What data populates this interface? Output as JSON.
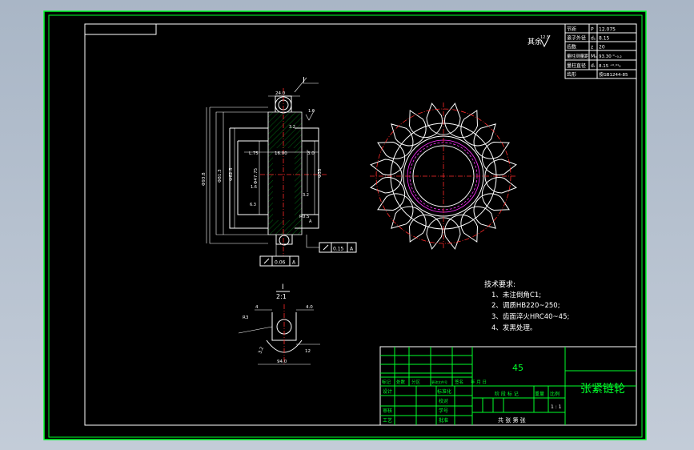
{
  "drawing": {
    "roughness_symbol": "其余",
    "roughness_value": "12.5",
    "material_cell": "45",
    "part_name": "张紧链轮"
  },
  "parameters_table": [
    {
      "label": "节距",
      "symbol": "P",
      "value": "12.075"
    },
    {
      "label": "滚子外径",
      "symbol": "d₁",
      "value": "8.15"
    },
    {
      "label": "齿数",
      "symbol": "z",
      "value": "20"
    },
    {
      "label": "量柱测量距",
      "symbol": "Mᵤ",
      "value": "93.30 ⁰₋₀.₂"
    },
    {
      "label": "量柱直径",
      "symbol": "dᵣ",
      "value": "8.15 ⁺⁰·⁰¹₀"
    },
    {
      "label": "齿形",
      "symbol": "",
      "value": "按GB1244-85"
    }
  ],
  "tech_requirements": {
    "title": "技术要求:",
    "items": [
      "1、未注倒角C1;",
      "2、调质HB220~250;",
      "3、齿面淬火HRC40~45;",
      "4、发黑处理。"
    ]
  },
  "detail_view": {
    "label": "I",
    "scale": "2:1",
    "dim_width": "4",
    "dim_right": "4.0",
    "dim_r": "R3",
    "dim_left": "3.2",
    "dim_angle": "12",
    "dim_bottom": "94.0"
  },
  "section_view": {
    "label": "I",
    "dim_top": "24.0",
    "dim_left_outer": "Φ93.8",
    "dim_left_mid": "Φ81.3",
    "dim_inner_mid": "Φ62.5",
    "dim_bore": "Φ47.75",
    "dim_right": "Φ35",
    "dim_len": "L.75",
    "dim_hub": "16.00",
    "dim_chamfer": "3.0",
    "dim_r": "R0.5",
    "dim_ra1": "1.6",
    "dim_ra2": "3.2",
    "dim_ra3": "1.6",
    "dim_ra4": "3.2",
    "dim_ra5": "6.3",
    "tol1_value": "0.06",
    "tol1_datum": "A",
    "tol2_value": "0.15",
    "tol2_datum": "A",
    "datum_label": "A"
  },
  "title_block": {
    "row_labels": [
      "标记",
      "处数",
      "分区",
      "更改文件号",
      "签名",
      "年 月 日"
    ],
    "designer": "设计",
    "standardization": "标准化",
    "reviewer": "审核",
    "process": "工艺",
    "approve": "批准",
    "verify": "校对",
    "stage_labels": [
      "阶 段 标 记",
      "重量",
      "比例"
    ],
    "scale_value": "1 : 1",
    "sheet_text": "共   张  第   张",
    "student_no": "学号",
    "review2": "审核"
  }
}
